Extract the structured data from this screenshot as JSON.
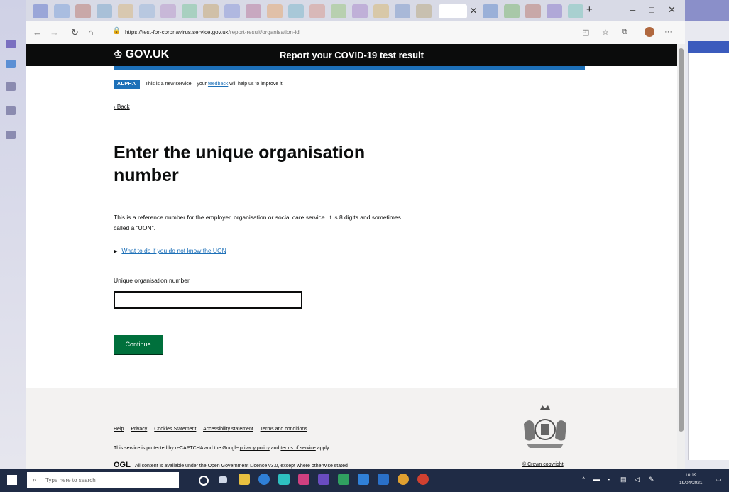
{
  "browser": {
    "url_host": "https://test-for-coronavirus.service.gov.uk",
    "url_path": "/report-result/organisation-id"
  },
  "header": {
    "logo_text": "GOV.UK",
    "service_name": "Report your COVID-19 test result"
  },
  "phase_banner": {
    "tag": "ALPHA",
    "text_before": "This is a new service – your ",
    "link": "feedback",
    "text_after": " will help us to improve it."
  },
  "back_link": "Back",
  "heading": "Enter the unique organisation number",
  "hint_paragraph": "This is a reference number for the employer, organisation or social care service. It is 8 digits and sometimes called a \"UON\".",
  "details_summary": "What to do if you do not know the UON",
  "field": {
    "label": "Unique organisation number",
    "value": ""
  },
  "continue_button": "Continue",
  "footer": {
    "links": [
      "Help",
      "Privacy",
      "Cookies Statement",
      "Accessibility statement",
      "Terms and conditions"
    ],
    "recaptcha_before": "This service is protected by reCAPTCHA and the Google ",
    "privacy_policy": "privacy policy",
    "recaptcha_mid": " and ",
    "terms_of_service": "terms of service",
    "recaptcha_after": " apply.",
    "ogl_mark": "OGL",
    "ogl_text": "All content is available under the Open Government Licence v3.0, except where otherwise stated",
    "crown_copyright": "© Crown copyright"
  },
  "taskbar": {
    "search_placeholder": "Type here to search",
    "time": "10:19",
    "date": "19/04/2021"
  }
}
